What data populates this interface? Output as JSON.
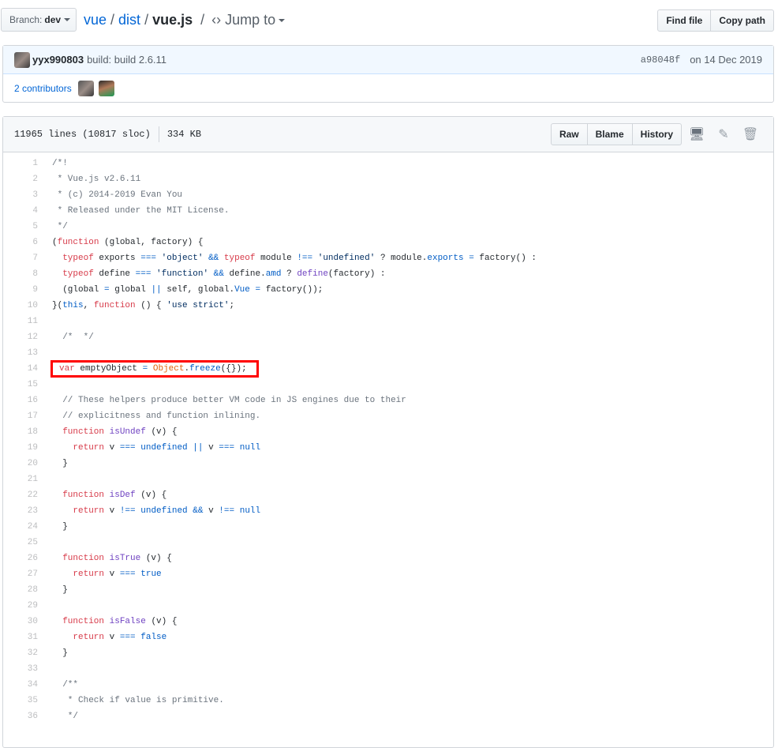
{
  "nav": {
    "branch_label": "Branch:",
    "branch": "dev",
    "crumbs": [
      "vue",
      "dist"
    ],
    "file": "vue.js",
    "jump": "Jump to",
    "find_file": "Find file",
    "copy_path": "Copy path"
  },
  "commit": {
    "author": "yyx990803",
    "message": "build: build 2.6.11",
    "sha": "a98048f",
    "date": "on 14 Dec 2019",
    "contributors": "2 contributors"
  },
  "file": {
    "lines": "11965 lines (10817 sloc)",
    "size": "334 KB",
    "raw": "Raw",
    "blame": "Blame",
    "history": "History"
  },
  "colors": {
    "highlight": "#ff0000",
    "link": "#0366d6"
  },
  "code": [
    {
      "n": "1",
      "t": [
        [
          "c",
          "/*!"
        ]
      ]
    },
    {
      "n": "2",
      "t": [
        [
          "c",
          " * Vue.js v2.6.11"
        ]
      ]
    },
    {
      "n": "3",
      "t": [
        [
          "c",
          " * (c) 2014-2019 Evan You"
        ]
      ]
    },
    {
      "n": "4",
      "t": [
        [
          "c",
          " * Released under the MIT License."
        ]
      ]
    },
    {
      "n": "5",
      "t": [
        [
          "c",
          " */"
        ]
      ]
    },
    {
      "n": "6",
      "t": [
        [
          "t",
          "("
        ],
        [
          "k",
          "function"
        ],
        [
          "t",
          " (global, factory) {"
        ]
      ]
    },
    {
      "n": "7",
      "t": [
        [
          "t",
          "  "
        ],
        [
          "k",
          "typeof"
        ],
        [
          "t",
          " exports "
        ],
        [
          "p",
          "==="
        ],
        [
          "t",
          " "
        ],
        [
          "s",
          "'object'"
        ],
        [
          "t",
          " "
        ],
        [
          "p",
          "&&"
        ],
        [
          "t",
          " "
        ],
        [
          "k",
          "typeof"
        ],
        [
          "t",
          " module "
        ],
        [
          "p",
          "!=="
        ],
        [
          "t",
          " "
        ],
        [
          "s",
          "'undefined'"
        ],
        [
          "t",
          " ? module."
        ],
        [
          "p",
          "exports"
        ],
        [
          "t",
          " "
        ],
        [
          "p",
          "="
        ],
        [
          "t",
          " factory() :"
        ]
      ]
    },
    {
      "n": "8",
      "t": [
        [
          "t",
          "  "
        ],
        [
          "k",
          "typeof"
        ],
        [
          "t",
          " define "
        ],
        [
          "p",
          "==="
        ],
        [
          "t",
          " "
        ],
        [
          "s",
          "'function'"
        ],
        [
          "t",
          " "
        ],
        [
          "p",
          "&&"
        ],
        [
          "t",
          " define."
        ],
        [
          "p",
          "amd"
        ],
        [
          "t",
          " ? "
        ],
        [
          "f",
          "define"
        ],
        [
          "t",
          "(factory) :"
        ]
      ]
    },
    {
      "n": "9",
      "t": [
        [
          "t",
          "  (global "
        ],
        [
          "p",
          "="
        ],
        [
          "t",
          " global "
        ],
        [
          "p",
          "||"
        ],
        [
          "t",
          " self, global."
        ],
        [
          "p",
          "Vue"
        ],
        [
          "t",
          " "
        ],
        [
          "p",
          "="
        ],
        [
          "t",
          " factory());"
        ]
      ]
    },
    {
      "n": "10",
      "t": [
        [
          "t",
          "}("
        ],
        [
          "p",
          "this"
        ],
        [
          "t",
          ", "
        ],
        [
          "k",
          "function"
        ],
        [
          "t",
          " () { "
        ],
        [
          "s",
          "'use strict'"
        ],
        [
          "t",
          ";"
        ]
      ]
    },
    {
      "n": "11",
      "t": []
    },
    {
      "n": "12",
      "t": [
        [
          "c",
          "  /*  */"
        ]
      ]
    },
    {
      "n": "13",
      "t": []
    },
    {
      "n": "14",
      "highlighted": true,
      "t": [
        [
          "k",
          "var"
        ],
        [
          "t",
          " emptyObject "
        ],
        [
          "p",
          "="
        ],
        [
          "t",
          " "
        ],
        [
          "o",
          "Object"
        ],
        [
          "t",
          "."
        ],
        [
          "p",
          "freeze"
        ],
        [
          "t",
          "({});"
        ]
      ]
    },
    {
      "n": "15",
      "t": []
    },
    {
      "n": "16",
      "t": [
        [
          "c",
          "  // These helpers produce better VM code in JS engines due to their"
        ]
      ]
    },
    {
      "n": "17",
      "t": [
        [
          "c",
          "  // explicitness and function inlining."
        ]
      ]
    },
    {
      "n": "18",
      "t": [
        [
          "t",
          "  "
        ],
        [
          "k",
          "function"
        ],
        [
          "t",
          " "
        ],
        [
          "f",
          "isUndef"
        ],
        [
          "t",
          " (v) {"
        ]
      ]
    },
    {
      "n": "19",
      "t": [
        [
          "t",
          "    "
        ],
        [
          "k",
          "return"
        ],
        [
          "t",
          " v "
        ],
        [
          "p",
          "==="
        ],
        [
          "t",
          " "
        ],
        [
          "p",
          "undefined"
        ],
        [
          "t",
          " "
        ],
        [
          "p",
          "||"
        ],
        [
          "t",
          " v "
        ],
        [
          "p",
          "==="
        ],
        [
          "t",
          " "
        ],
        [
          "p",
          "null"
        ]
      ]
    },
    {
      "n": "20",
      "t": [
        [
          "t",
          "  }"
        ]
      ]
    },
    {
      "n": "21",
      "t": []
    },
    {
      "n": "22",
      "t": [
        [
          "t",
          "  "
        ],
        [
          "k",
          "function"
        ],
        [
          "t",
          " "
        ],
        [
          "f",
          "isDef"
        ],
        [
          "t",
          " (v) {"
        ]
      ]
    },
    {
      "n": "23",
      "t": [
        [
          "t",
          "    "
        ],
        [
          "k",
          "return"
        ],
        [
          "t",
          " v "
        ],
        [
          "p",
          "!=="
        ],
        [
          "t",
          " "
        ],
        [
          "p",
          "undefined"
        ],
        [
          "t",
          " "
        ],
        [
          "p",
          "&&"
        ],
        [
          "t",
          " v "
        ],
        [
          "p",
          "!=="
        ],
        [
          "t",
          " "
        ],
        [
          "p",
          "null"
        ]
      ]
    },
    {
      "n": "24",
      "t": [
        [
          "t",
          "  }"
        ]
      ]
    },
    {
      "n": "25",
      "t": []
    },
    {
      "n": "26",
      "t": [
        [
          "t",
          "  "
        ],
        [
          "k",
          "function"
        ],
        [
          "t",
          " "
        ],
        [
          "f",
          "isTrue"
        ],
        [
          "t",
          " (v) {"
        ]
      ]
    },
    {
      "n": "27",
      "t": [
        [
          "t",
          "    "
        ],
        [
          "k",
          "return"
        ],
        [
          "t",
          " v "
        ],
        [
          "p",
          "==="
        ],
        [
          "t",
          " "
        ],
        [
          "p",
          "true"
        ]
      ]
    },
    {
      "n": "28",
      "t": [
        [
          "t",
          "  }"
        ]
      ]
    },
    {
      "n": "29",
      "t": []
    },
    {
      "n": "30",
      "t": [
        [
          "t",
          "  "
        ],
        [
          "k",
          "function"
        ],
        [
          "t",
          " "
        ],
        [
          "f",
          "isFalse"
        ],
        [
          "t",
          " (v) {"
        ]
      ]
    },
    {
      "n": "31",
      "t": [
        [
          "t",
          "    "
        ],
        [
          "k",
          "return"
        ],
        [
          "t",
          " v "
        ],
        [
          "p",
          "==="
        ],
        [
          "t",
          " "
        ],
        [
          "p",
          "false"
        ]
      ]
    },
    {
      "n": "32",
      "t": [
        [
          "t",
          "  }"
        ]
      ]
    },
    {
      "n": "33",
      "t": []
    },
    {
      "n": "34",
      "t": [
        [
          "c",
          "  /**"
        ]
      ]
    },
    {
      "n": "35",
      "t": [
        [
          "c",
          "   * Check if value is primitive."
        ]
      ]
    },
    {
      "n": "36",
      "t": [
        [
          "c",
          "   */"
        ]
      ]
    }
  ]
}
